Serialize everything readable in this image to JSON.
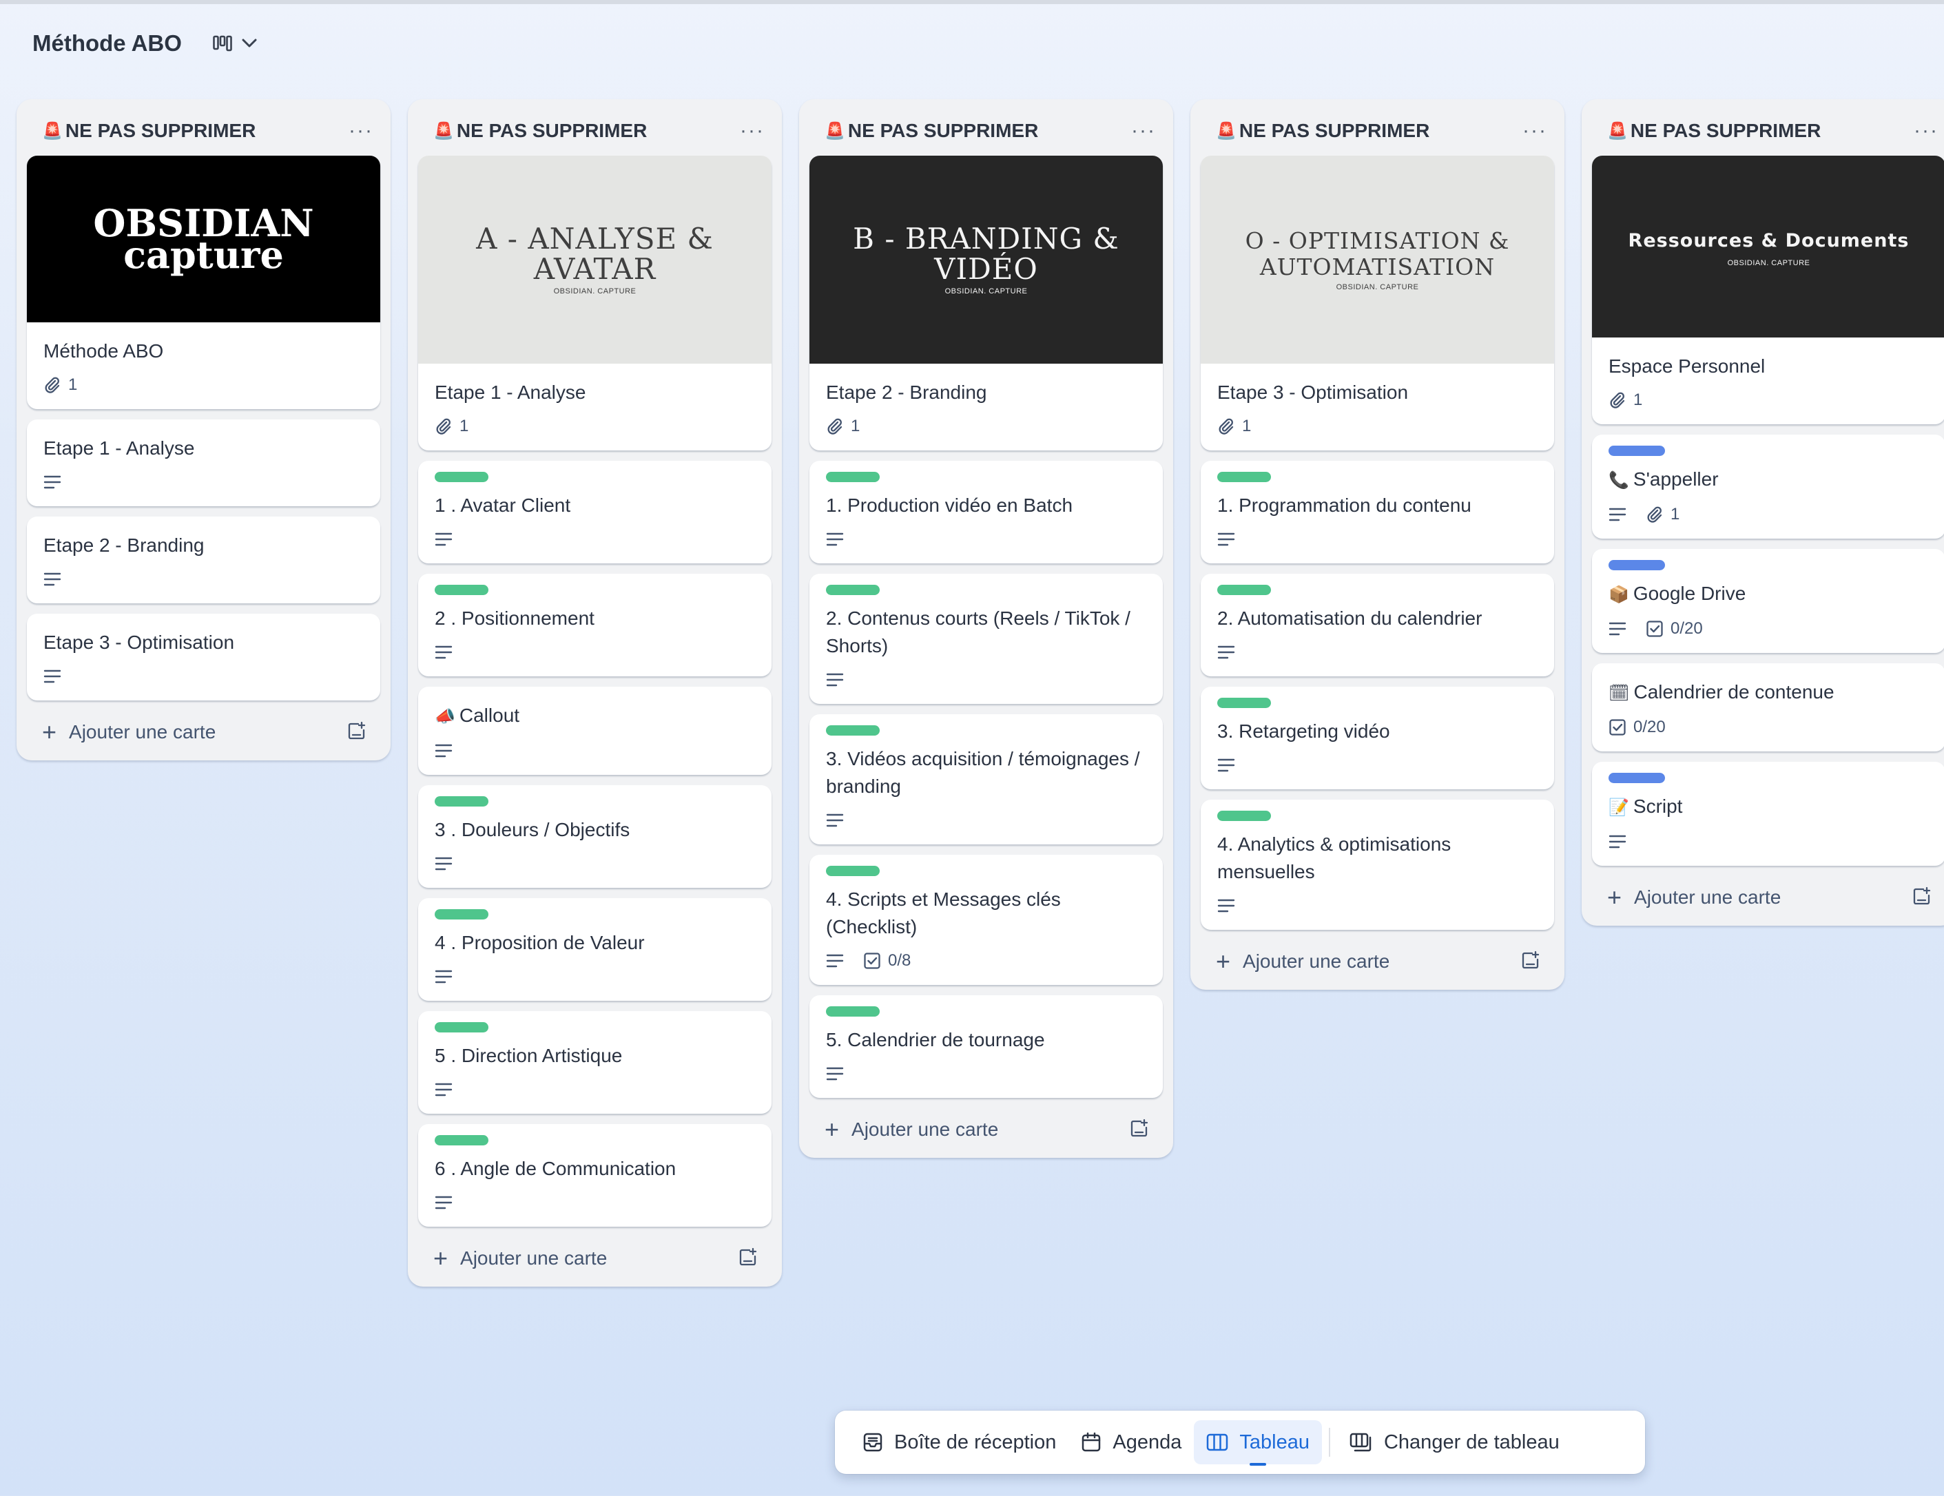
{
  "board": {
    "title": "Méthode ABO"
  },
  "ui": {
    "add_card": "Ajouter une carte",
    "more": "···"
  },
  "lists": [
    {
      "title": "NE PAS SUPPRIMER",
      "cards": [
        {
          "title": "Méthode ABO",
          "cover": {
            "style": "black",
            "main": "OBSIDIAN capture",
            "sub": ""
          },
          "attachments": "1"
        },
        {
          "title": "Etape 1 - Analyse",
          "description": true
        },
        {
          "title": "Etape 2 - Branding",
          "description": true
        },
        {
          "title": "Etape 3 - Optimisation",
          "description": true
        }
      ]
    },
    {
      "title": "NE PAS SUPPRIMER",
      "cards": [
        {
          "title": "Etape 1 - Analyse",
          "cover": {
            "style": "light",
            "main": "A - ANALYSE & AVATAR",
            "sub": "OBSIDIAN. CAPTURE"
          },
          "attachments": "1"
        },
        {
          "title": "1 . Avatar Client",
          "label": "green",
          "description": true
        },
        {
          "title": "2 . Positionnement",
          "label": "green",
          "description": true
        },
        {
          "title": "Callout",
          "emoji": "📣",
          "description": true
        },
        {
          "title": "3 . Douleurs / Objectifs",
          "label": "green",
          "description": true
        },
        {
          "title": "4 . Proposition de Valeur",
          "label": "green",
          "description": true
        },
        {
          "title": "5 . Direction Artistique",
          "label": "green",
          "description": true
        },
        {
          "title": "6 . Angle de Communication",
          "label": "green",
          "description": true
        }
      ]
    },
    {
      "title": "NE PAS SUPPRIMER",
      "cards": [
        {
          "title": "Etape 2 - Branding",
          "cover": {
            "style": "dark",
            "main": "B - BRANDING & VIDÉO",
            "sub": "OBSIDIAN. CAPTURE"
          },
          "attachments": "1"
        },
        {
          "title": "1. Production vidéo en Batch",
          "label": "green",
          "description": true
        },
        {
          "title": "2. Contenus courts (Reels / TikTok / Shorts)",
          "label": "green",
          "description": true
        },
        {
          "title": "3. Vidéos acquisition / témoignages / branding",
          "label": "green",
          "description": true
        },
        {
          "title": "4. Scripts et Messages clés (Checklist)",
          "label": "green",
          "description": true,
          "checklist": "0/8"
        },
        {
          "title": "5. Calendrier de tournage",
          "label": "green",
          "description": true
        }
      ]
    },
    {
      "title": "NE PAS SUPPRIMER",
      "cards": [
        {
          "title": "Etape 3 - Optimisation",
          "cover": {
            "style": "light",
            "main": "O - OPTIMISATION & AUTOMATISATION",
            "sub": "OBSIDIAN. CAPTURE"
          },
          "attachments": "1"
        },
        {
          "title": "1. Programmation du contenu",
          "label": "green",
          "description": true
        },
        {
          "title": "2. Automatisation du calendrier",
          "label": "green",
          "description": true
        },
        {
          "title": "3. Retargeting vidéo",
          "label": "green",
          "description": true
        },
        {
          "title": "4. Analytics & optimisations mensuelles",
          "label": "green",
          "description": true
        }
      ]
    },
    {
      "title": "NE PAS SUPPRIMER",
      "cards": [
        {
          "title": "Espace Personnel",
          "cover": {
            "style": "dark",
            "main": "Ressources & Documents",
            "sub": "OBSIDIAN. CAPTURE"
          },
          "attachments": "1"
        },
        {
          "title": "S'appeller",
          "emoji": "📞",
          "label": "blue",
          "description": true,
          "attachments": "1"
        },
        {
          "title": "Google Drive",
          "emoji": "📦",
          "label": "blue",
          "description": true,
          "checklist": "0/20"
        },
        {
          "title": "Calendrier de contenue",
          "emoji": "🗓",
          "checklist": "0/20"
        },
        {
          "title": "Script",
          "emoji": "📝",
          "label": "blue",
          "description": true
        }
      ]
    }
  ],
  "bottom_nav": [
    {
      "label": "Boîte de réception",
      "icon": "inbox-icon",
      "active": false
    },
    {
      "label": "Agenda",
      "icon": "calendar-icon",
      "active": false
    },
    {
      "label": "Tableau",
      "icon": "board-icon",
      "active": true
    },
    {
      "label": "Changer de tableau",
      "icon": "switch-board-icon",
      "active": false
    }
  ],
  "colors": {
    "green_label": "#4fc58c",
    "blue_label": "#5b87e8",
    "active_nav": "#1d6ad8"
  }
}
